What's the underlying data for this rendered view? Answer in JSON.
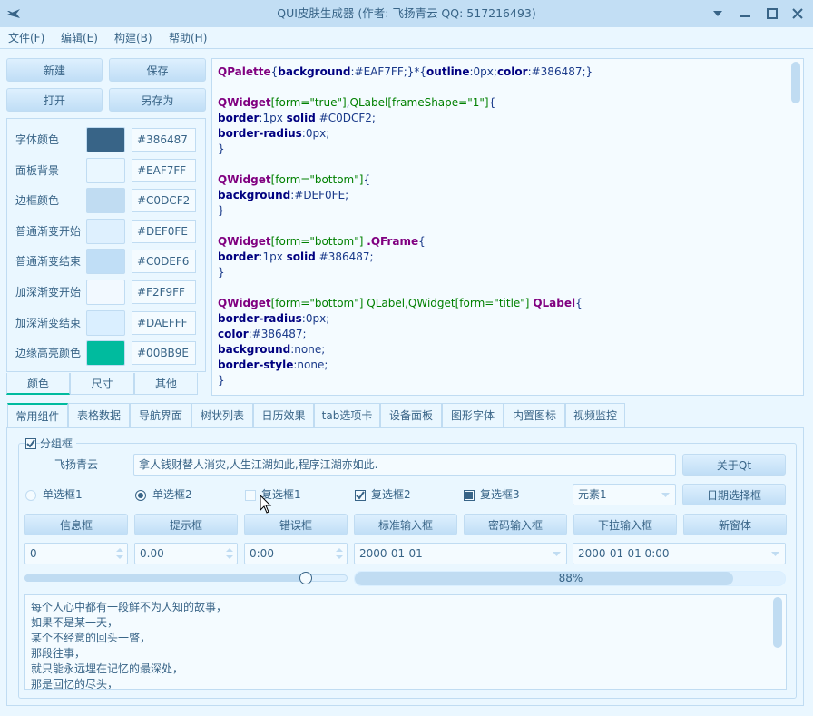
{
  "window": {
    "title": "QUI皮肤生成器 (作者: 飞扬青云  QQ: 517216493)",
    "icons": [
      "airplane-icon",
      "dropdown-icon",
      "minimize-icon",
      "maximize-icon",
      "close-icon"
    ]
  },
  "menu": [
    "文件(F)",
    "编辑(E)",
    "构建(B)",
    "帮助(H)"
  ],
  "file_buttons": [
    "新建",
    "保存",
    "打开",
    "另存为"
  ],
  "color_rows": [
    {
      "label": "字体颜色",
      "color": "#386487",
      "value": "#386487"
    },
    {
      "label": "面板背景",
      "color": "#EAF7FF",
      "value": "#EAF7FF"
    },
    {
      "label": "边框颜色",
      "color": "#C0DCF2",
      "value": "#C0DCF2"
    },
    {
      "label": "普通渐变开始",
      "color": "#DEF0FE",
      "value": "#DEF0FE"
    },
    {
      "label": "普通渐变结束",
      "color": "#C0DEF6",
      "value": "#C0DEF6"
    },
    {
      "label": "加深渐变开始",
      "color": "#F2F9FF",
      "value": "#F2F9FF"
    },
    {
      "label": "加深渐变结束",
      "color": "#DAEFFF",
      "value": "#DAEFFF"
    },
    {
      "label": "边缘高亮颜色",
      "color": "#00BB9E",
      "value": "#00BB9E"
    }
  ],
  "panel_tabs": [
    "颜色",
    "尺寸",
    "其他"
  ],
  "code": [
    [
      [
        "k",
        "QPalette"
      ],
      [
        "v",
        "{"
      ],
      [
        "p",
        "background"
      ],
      [
        "v",
        ":#EAF7FF;}*{"
      ],
      [
        "p",
        "outline"
      ],
      [
        "v",
        ":0px;"
      ],
      [
        "p",
        "color"
      ],
      [
        "v",
        ":#386487;}"
      ]
    ],
    [],
    [
      [
        "k",
        "QWidget"
      ],
      [
        "s",
        "[form=\"true\"]"
      ],
      [
        "v",
        ","
      ],
      [
        "s",
        "QLabel[frameShape=\"1\"]"
      ],
      [
        "v",
        "{"
      ]
    ],
    [
      [
        "p",
        "border"
      ],
      [
        "v",
        ":1px "
      ],
      [
        "p",
        "solid"
      ],
      [
        "v",
        " #C0DCF2;"
      ]
    ],
    [
      [
        "p",
        "border-radius"
      ],
      [
        "v",
        ":0px;"
      ]
    ],
    [
      [
        "v",
        "}"
      ]
    ],
    [],
    [
      [
        "k",
        "QWidget"
      ],
      [
        "s",
        "[form=\"bottom\"]"
      ],
      [
        "v",
        "{"
      ]
    ],
    [
      [
        "p",
        "background"
      ],
      [
        "v",
        ":#DEF0FE;"
      ]
    ],
    [
      [
        "v",
        "}"
      ]
    ],
    [],
    [
      [
        "k",
        "QWidget"
      ],
      [
        "s",
        "[form=\"bottom\"] "
      ],
      [
        "k",
        ".QFrame"
      ],
      [
        "v",
        "{"
      ]
    ],
    [
      [
        "p",
        "border"
      ],
      [
        "v",
        ":1px "
      ],
      [
        "p",
        "solid"
      ],
      [
        "v",
        " #386487;"
      ]
    ],
    [
      [
        "v",
        "}"
      ]
    ],
    [],
    [
      [
        "k",
        "QWidget"
      ],
      [
        "s",
        "[form=\"bottom\"] QLabel,QWidget[form=\"title\"] "
      ],
      [
        "k",
        "QLabel"
      ],
      [
        "v",
        "{"
      ]
    ],
    [
      [
        "p",
        "border-radius"
      ],
      [
        "v",
        ":0px;"
      ]
    ],
    [
      [
        "p",
        "color"
      ],
      [
        "v",
        ":#386487;"
      ]
    ],
    [
      [
        "p",
        "background"
      ],
      [
        "v",
        ":none;"
      ]
    ],
    [
      [
        "p",
        "border-style"
      ],
      [
        "v",
        ":none;"
      ]
    ],
    [
      [
        "v",
        "}"
      ]
    ]
  ],
  "main_tabs": [
    "常用组件",
    "表格数据",
    "导航界面",
    "树状列表",
    "日历效果",
    "tab选项卡",
    "设备面板",
    "图形字体",
    "内置图标",
    "视频监控"
  ],
  "group": {
    "title": "分组框",
    "name_label": "飞扬青云",
    "line_edit": "拿人钱财替人消灾,人生江湖如此,程序江湖亦如此.",
    "about_button": "关于Qt",
    "radio1": "单选框1",
    "radio2": "单选框2",
    "check1": "复选框1",
    "check2": "复选框2",
    "check3": "复选框3",
    "combo": "元素1",
    "date_button": "日期选择框",
    "buttons": [
      "信息框",
      "提示框",
      "错误框",
      "标准输入框",
      "密码输入框",
      "下拉输入框",
      "新窗体"
    ],
    "spin_int": "0",
    "spin_double": "0.00",
    "time_edit": "0:00",
    "date_edit": "2000-01-01",
    "datetime_edit": "2000-01-01 0:00",
    "slider_value": 0.87,
    "progress_value": 0.88,
    "progress_text": "88%",
    "text_lines": [
      "每个人心中都有一段鲜不为人知的故事，",
      "如果不是某一天，",
      "某个不经意的回头一瞥，",
      "那段往事，",
      "就只能永远埋在记忆的最深处，",
      "那是回忆的尽头，"
    ]
  }
}
